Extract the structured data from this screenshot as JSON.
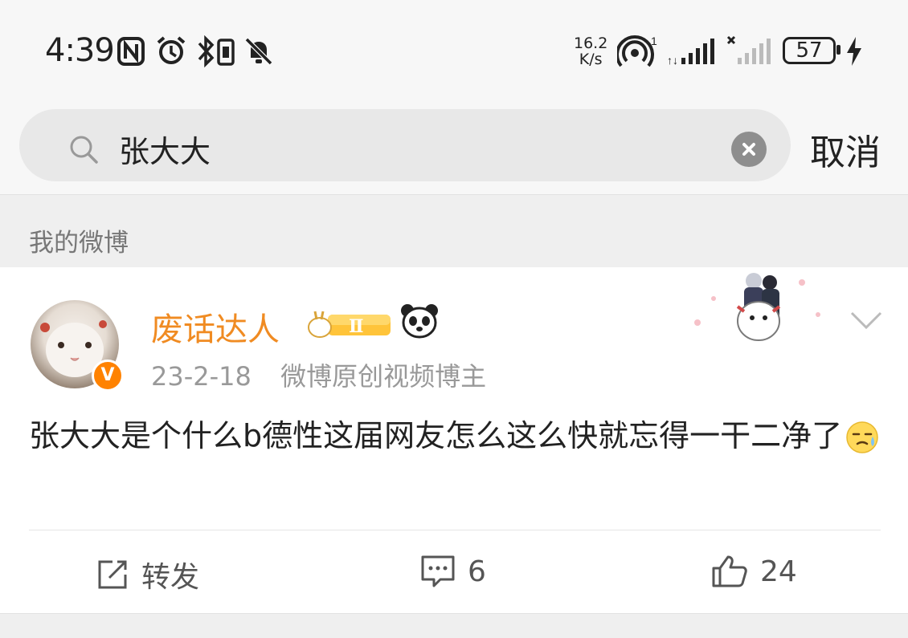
{
  "status_bar": {
    "time": "4:39",
    "speed_value": "16.2",
    "speed_unit": "K/s",
    "wifi_badge": "1",
    "battery": "57",
    "icons": [
      "nfc-icon",
      "alarm-icon",
      "bluetooth-icon",
      "vibrate-icon",
      "mute-icon",
      "hotspot-icon",
      "signal-icon",
      "signal-off-icon",
      "charging-icon"
    ]
  },
  "search": {
    "query": "张大大",
    "cancel_label": "取消"
  },
  "section": {
    "title": "我的微博"
  },
  "post": {
    "username": "废话达人",
    "level": "Ⅱ",
    "verified": "V",
    "date": "23-2-18",
    "tag": "微博原创视频博主",
    "content": "张大大是个什么b德性这届网友怎么这么快就忘得一干二净了",
    "actions": {
      "repost_label": "转发",
      "comment_count": "6",
      "like_count": "24"
    }
  },
  "colors": {
    "username": "#f08b22",
    "verify": "#ff8200",
    "background": "#ffffff",
    "header_bg": "#f7f7f7"
  }
}
